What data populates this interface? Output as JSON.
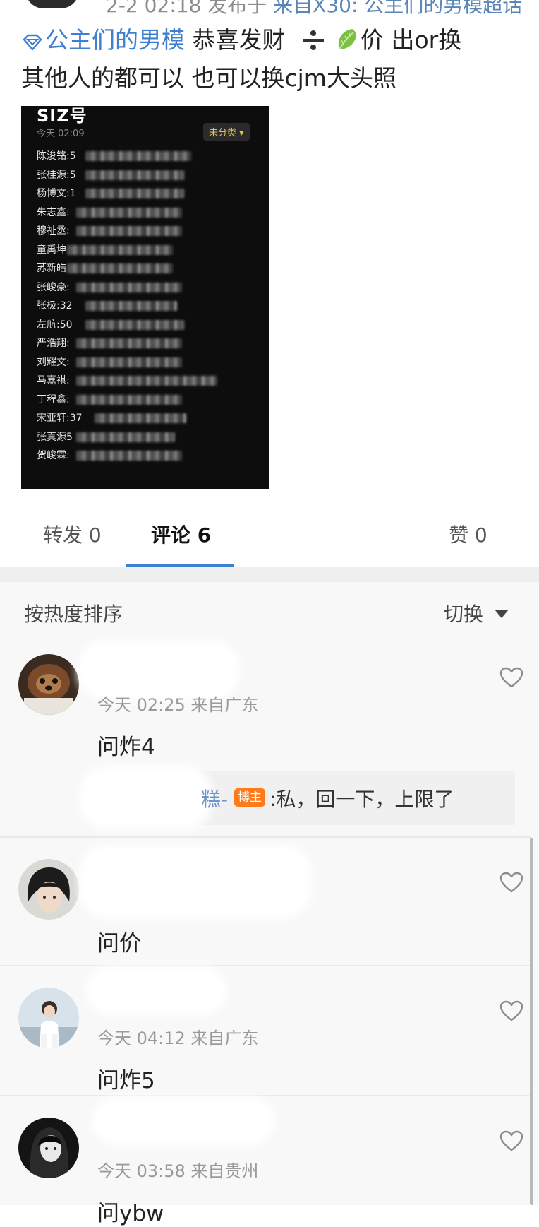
{
  "header": {
    "partial_text": "2-2 02:18 发布于",
    "partial_topic": "来自X30: 公主们的男模超话"
  },
  "post": {
    "topic": "公主们的男模",
    "line1_rest": " 恭喜发财",
    "line1_after_icons": "价 出or换",
    "line2": "其他人的都可以  也可以换cjm大头照"
  },
  "note_image": {
    "title": "SIZ号",
    "date": "今天 02:09",
    "chip": "未分类 ▾",
    "rows": [
      "陈浚铭:5",
      "张桂源:5",
      "杨博文:1",
      "朱志鑫:",
      "穆祉丞:",
      "童禹坤",
      "苏新皓",
      "张峻豪:",
      "张极:32",
      "左航:50",
      "严浩翔:",
      "刘耀文:",
      "马嘉祺:",
      "丁程鑫:",
      "宋亚轩:37",
      "张真源5",
      "贺峻霖:"
    ]
  },
  "tabs": [
    {
      "label": "转发 0"
    },
    {
      "label": "评论 6"
    },
    {
      "label": "赞 0"
    }
  ],
  "sort": {
    "label": "按热度排序",
    "switch_label": "切换"
  },
  "comments": [
    {
      "meta": "今天 02:25 来自广东",
      "text": "问炸4",
      "reply": {
        "author": "糕-",
        "badge": "博主",
        "text": ":私，回一下，上限了"
      }
    },
    {
      "meta": "",
      "text": "问价"
    },
    {
      "meta": "今天 04:12 来自广东",
      "text": "问炸5"
    },
    {
      "meta": "今天 03:58 来自贵州",
      "text": "问ybw"
    }
  ],
  "colors": {
    "accent": "#3f7fcf",
    "badge": "#ff7a1a",
    "link": "#6f93c8"
  }
}
